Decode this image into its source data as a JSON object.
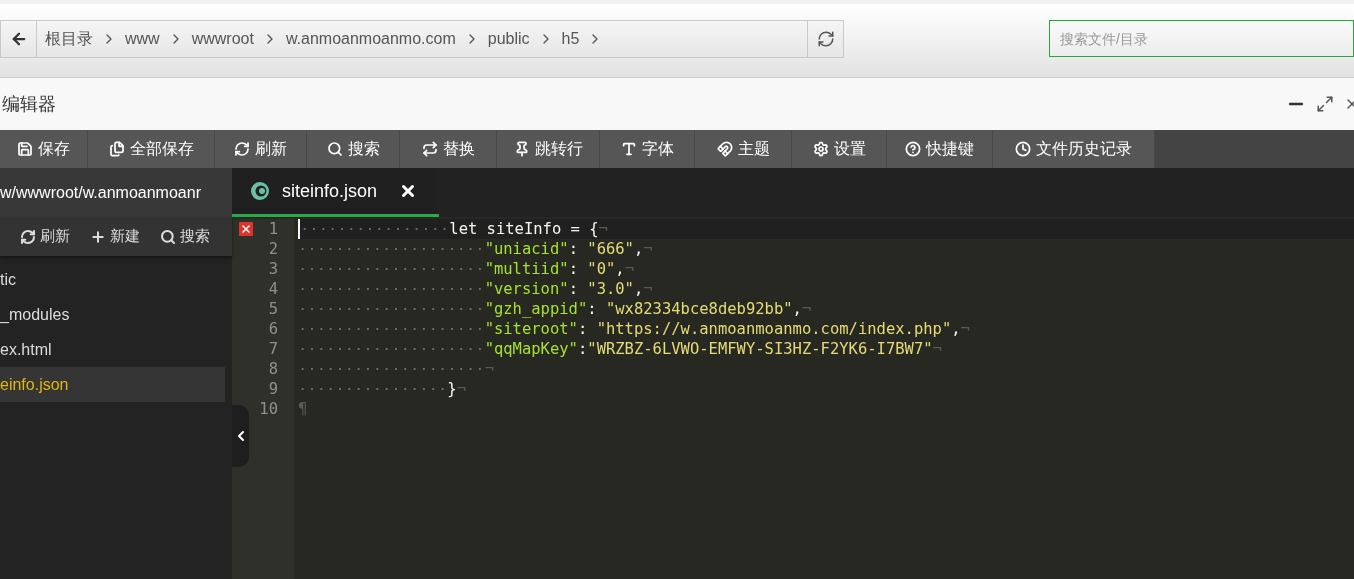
{
  "breadcrumb": [
    "根目录",
    "www",
    "wwwroot",
    "w.anmoanmoanmo.com",
    "public",
    "h5"
  ],
  "search": {
    "placeholder": "搜索文件/目录"
  },
  "window": {
    "title": "编辑器"
  },
  "toolbar": [
    {
      "label": "保存",
      "kind": "save"
    },
    {
      "label": "全部保存",
      "kind": "saveall"
    },
    {
      "label": "刷新",
      "kind": "refresh"
    },
    {
      "label": "搜索",
      "kind": "search"
    },
    {
      "label": "替换",
      "kind": "replace"
    },
    {
      "label": "跳转行",
      "kind": "goto"
    },
    {
      "label": "字体",
      "kind": "font"
    },
    {
      "label": "主题",
      "kind": "theme"
    },
    {
      "label": "设置",
      "kind": "settings"
    },
    {
      "label": "快捷键",
      "kind": "shortcuts"
    },
    {
      "label": "文件历史记录",
      "kind": "history"
    }
  ],
  "sidebar": {
    "path": "w/wwwroot/w.anmoanmoanr",
    "actions": [
      {
        "label": "刷新",
        "kind": "refresh"
      },
      {
        "label": "新建",
        "kind": "new"
      },
      {
        "label": "搜索",
        "kind": "search"
      }
    ],
    "files": [
      {
        "name": "tic",
        "selected": false
      },
      {
        "name": "_modules",
        "selected": false
      },
      {
        "name": "ex.html",
        "selected": false
      },
      {
        "name": "einfo.json",
        "selected": true
      }
    ]
  },
  "tabs": [
    {
      "label": "siteinfo.json",
      "selected": true
    }
  ],
  "editor": {
    "lines": [
      {
        "number": "1",
        "error": true,
        "active": true,
        "tokens": [
          {
            "kind": "indent1"
          },
          {
            "kind": "plain",
            "text": "let siteInfo = {"
          },
          {
            "kind": "eol",
            "text": "¬"
          }
        ]
      },
      {
        "number": "2",
        "error": false,
        "active": false,
        "tokens": [
          {
            "kind": "indent2"
          },
          {
            "kind": "key",
            "text": "\"uniacid\""
          },
          {
            "kind": "plain",
            "text": ": "
          },
          {
            "kind": "string",
            "text": "\"666\""
          },
          {
            "kind": "plain",
            "text": ","
          },
          {
            "kind": "eol",
            "text": "¬"
          }
        ]
      },
      {
        "number": "3",
        "error": false,
        "active": false,
        "tokens": [
          {
            "kind": "indent2"
          },
          {
            "kind": "key",
            "text": "\"multiid\""
          },
          {
            "kind": "plain",
            "text": ": "
          },
          {
            "kind": "string",
            "text": "\"0\""
          },
          {
            "kind": "plain",
            "text": ","
          },
          {
            "kind": "eol",
            "text": "¬"
          }
        ]
      },
      {
        "number": "4",
        "error": false,
        "active": false,
        "tokens": [
          {
            "kind": "indent2"
          },
          {
            "kind": "key",
            "text": "\"version\""
          },
          {
            "kind": "plain",
            "text": ": "
          },
          {
            "kind": "string",
            "text": "\"3.0\""
          },
          {
            "kind": "plain",
            "text": ","
          },
          {
            "kind": "eol",
            "text": "¬"
          }
        ]
      },
      {
        "number": "5",
        "error": false,
        "active": false,
        "tokens": [
          {
            "kind": "indent2"
          },
          {
            "kind": "key",
            "text": "\"gzh_appid\""
          },
          {
            "kind": "plain",
            "text": ": "
          },
          {
            "kind": "string",
            "text": "\"wx82334bce8deb92bb\""
          },
          {
            "kind": "plain",
            "text": ","
          },
          {
            "kind": "eol",
            "text": "¬"
          }
        ]
      },
      {
        "number": "6",
        "error": false,
        "active": false,
        "tokens": [
          {
            "kind": "indent2"
          },
          {
            "kind": "key",
            "text": "\"siteroot\""
          },
          {
            "kind": "plain",
            "text": ": "
          },
          {
            "kind": "string",
            "text": "\"https://w.anmoanmoanmo.com/index.php\""
          },
          {
            "kind": "plain",
            "text": ","
          },
          {
            "kind": "eol",
            "text": "¬"
          }
        ]
      },
      {
        "number": "7",
        "error": false,
        "active": false,
        "tokens": [
          {
            "kind": "indent2"
          },
          {
            "kind": "key",
            "text": "\"qqMapKey\""
          },
          {
            "kind": "plain",
            "text": ":"
          },
          {
            "kind": "string",
            "text": "\"WRZBZ-6LVWO-EMFWY-SI3HZ-F2YK6-I7BW7\""
          },
          {
            "kind": "eol",
            "text": "¬"
          }
        ]
      },
      {
        "number": "8",
        "error": false,
        "active": false,
        "tokens": [
          {
            "kind": "indent2"
          },
          {
            "kind": "eol",
            "text": "¬"
          }
        ]
      },
      {
        "number": "9",
        "error": false,
        "active": false,
        "tokens": [
          {
            "kind": "indent1"
          },
          {
            "kind": "plain",
            "text": "}"
          },
          {
            "kind": "eol",
            "text": "¬"
          }
        ]
      },
      {
        "number": "10",
        "error": false,
        "active": false,
        "tokens": [
          {
            "kind": "eol",
            "text": "¶"
          }
        ]
      }
    ]
  }
}
